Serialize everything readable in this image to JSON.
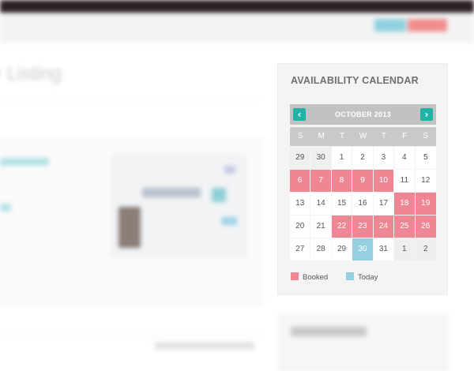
{
  "calendar": {
    "title": "AVAILABILITY CALENDAR",
    "month_label": "OCTOBER 2013",
    "prev_icon": "chevron-left-icon",
    "next_icon": "chevron-right-icon",
    "weekdays": [
      "S",
      "M",
      "T",
      "W",
      "T",
      "F",
      "S"
    ],
    "weeks": [
      [
        {
          "d": "29",
          "s": "muted"
        },
        {
          "d": "30",
          "s": "muted"
        },
        {
          "d": "1",
          "s": ""
        },
        {
          "d": "2",
          "s": ""
        },
        {
          "d": "3",
          "s": ""
        },
        {
          "d": "4",
          "s": ""
        },
        {
          "d": "5",
          "s": ""
        }
      ],
      [
        {
          "d": "6",
          "s": "booked"
        },
        {
          "d": "7",
          "s": "booked"
        },
        {
          "d": "8",
          "s": "booked"
        },
        {
          "d": "9",
          "s": "booked"
        },
        {
          "d": "10",
          "s": "booked"
        },
        {
          "d": "11",
          "s": ""
        },
        {
          "d": "12",
          "s": ""
        }
      ],
      [
        {
          "d": "13",
          "s": ""
        },
        {
          "d": "14",
          "s": ""
        },
        {
          "d": "15",
          "s": ""
        },
        {
          "d": "16",
          "s": ""
        },
        {
          "d": "17",
          "s": ""
        },
        {
          "d": "18",
          "s": "booked"
        },
        {
          "d": "19",
          "s": "booked"
        }
      ],
      [
        {
          "d": "20",
          "s": ""
        },
        {
          "d": "21",
          "s": ""
        },
        {
          "d": "22",
          "s": "booked"
        },
        {
          "d": "23",
          "s": "booked"
        },
        {
          "d": "24",
          "s": "booked"
        },
        {
          "d": "25",
          "s": "booked"
        },
        {
          "d": "26",
          "s": "booked"
        }
      ],
      [
        {
          "d": "27",
          "s": ""
        },
        {
          "d": "28",
          "s": ""
        },
        {
          "d": "29",
          "s": ""
        },
        {
          "d": "30",
          "s": "today"
        },
        {
          "d": "31",
          "s": ""
        },
        {
          "d": "1",
          "s": "muted"
        },
        {
          "d": "2",
          "s": "muted"
        }
      ]
    ],
    "legend": {
      "booked_label": "Booked",
      "today_label": "Today"
    }
  },
  "page": {
    "listing_title": "r Listing"
  },
  "colors": {
    "booked": "#ef8694",
    "today": "#95d0e0",
    "nav_accent": "#1fb3a8"
  }
}
